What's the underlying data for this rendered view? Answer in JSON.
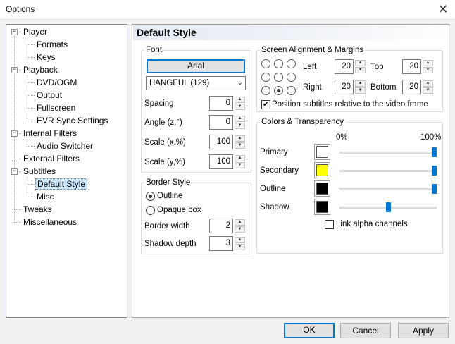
{
  "window": {
    "title": "Options",
    "close_glyph": "✕"
  },
  "tree": [
    {
      "label": "Player",
      "level": 0,
      "expander": "−"
    },
    {
      "label": "Formats",
      "level": 1
    },
    {
      "label": "Keys",
      "level": 1
    },
    {
      "label": "Playback",
      "level": 0,
      "expander": "−"
    },
    {
      "label": "DVD/OGM",
      "level": 1
    },
    {
      "label": "Output",
      "level": 1
    },
    {
      "label": "Fullscreen",
      "level": 1
    },
    {
      "label": "EVR Sync Settings",
      "level": 1
    },
    {
      "label": "Internal Filters",
      "level": 0,
      "expander": "−"
    },
    {
      "label": "Audio Switcher",
      "level": 1
    },
    {
      "label": "External Filters",
      "level": 0
    },
    {
      "label": "Subtitles",
      "level": 0,
      "expander": "−"
    },
    {
      "label": "Default Style",
      "level": 1,
      "selected": true
    },
    {
      "label": "Misc",
      "level": 1
    },
    {
      "label": "Tweaks",
      "level": 0
    },
    {
      "label": "Miscellaneous",
      "level": 0
    }
  ],
  "page": {
    "title": "Default Style"
  },
  "font": {
    "legend": "Font",
    "font_button": "Arial",
    "charset": "HANGEUL (129)",
    "charset_arrow": "⌄",
    "spacing_label": "Spacing",
    "spacing_value": "0",
    "angle_label": "Angle (z,°)",
    "angle_value": "0",
    "scalex_label": "Scale (x,%)",
    "scalex_value": "100",
    "scaley_label": "Scale (y,%)",
    "scaley_value": "100"
  },
  "border": {
    "legend": "Border Style",
    "outline_label": "Outline",
    "opaque_label": "Opaque box",
    "outline_selected": true,
    "width_label": "Border width",
    "width_value": "2",
    "shadow_label": "Shadow depth",
    "shadow_value": "3"
  },
  "alignment": {
    "legend": "Screen Alignment & Margins",
    "selected_position": "bottom-center",
    "left_label": "Left",
    "left_value": "20",
    "top_label": "Top",
    "top_value": "20",
    "right_label": "Right",
    "right_value": "20",
    "bottom_label": "Bottom",
    "bottom_value": "20",
    "relative_label": "Position subtitles relative to the video frame",
    "relative_checked": true
  },
  "colors": {
    "legend": "Colors & Transparency",
    "min_label": "0%",
    "max_label": "100%",
    "rows": [
      {
        "label": "Primary",
        "color": "#ffffff",
        "level": 1.0
      },
      {
        "label": "Secondary",
        "color": "#ffff00",
        "level": 1.0
      },
      {
        "label": "Outline",
        "color": "#000000",
        "level": 1.0
      },
      {
        "label": "Shadow",
        "color": "#000000",
        "level": 0.5
      }
    ],
    "link_label": "Link alpha channels",
    "link_checked": false
  },
  "buttons": {
    "ok": "OK",
    "cancel": "Cancel",
    "apply": "Apply"
  },
  "spin_up": "▲",
  "spin_down": "▼",
  "check_glyph": "✔"
}
